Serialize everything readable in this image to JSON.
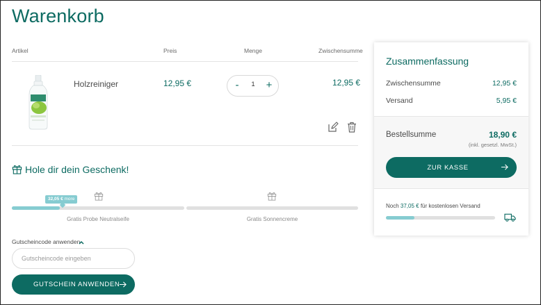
{
  "page": {
    "title": "Warenkorb"
  },
  "table": {
    "headers": {
      "article": "Artikel",
      "price": "Preis",
      "quantity": "Menge",
      "subtotal": "Zwischensumme"
    },
    "item": {
      "name": "Holzreiniger",
      "price": "12,95 €",
      "quantity": "1",
      "subtotal": "12,95 €",
      "decrease_label": "-",
      "increase_label": "+",
      "icons": {
        "image": "product-bottle-image",
        "edit": "edit-icon",
        "delete": "trash-icon"
      }
    }
  },
  "gift": {
    "title": "Hole dir dein Geschenk!",
    "icon": "gift-icon",
    "badge_amount": "32,05 €",
    "badge_suffix": "more",
    "progress": 0.28,
    "tiers": [
      {
        "label": "Gratis Probe Neutralseife"
      },
      {
        "label": "Gratis Sonnencreme"
      }
    ]
  },
  "coupon": {
    "toggle_label": "Gutscheincode anwenden",
    "placeholder": "Gutscheincode eingeben",
    "value": "",
    "button_label": "GUTSCHEIN ANWENDEN"
  },
  "summary": {
    "title": "Zusammenfassung",
    "rows": [
      {
        "label": "Zwischensumme",
        "value": "12,95 €"
      },
      {
        "label": "Versand",
        "value": "5,95 €"
      }
    ],
    "total_label": "Bestellsumme",
    "total_value": "18,90 €",
    "tax_note": "(inkl. gesetzl. MwSt.)",
    "checkout_label": "ZUR KASSE",
    "shipping": {
      "prefix": "Noch ",
      "amount": "37,05 €",
      "suffix": " für kostenlosen Versand",
      "progress": 0.26,
      "icon": "truck-icon"
    }
  },
  "colors": {
    "brand": "#0d6b62",
    "progress": "#86ccd1",
    "track": "#e0e0e0"
  }
}
